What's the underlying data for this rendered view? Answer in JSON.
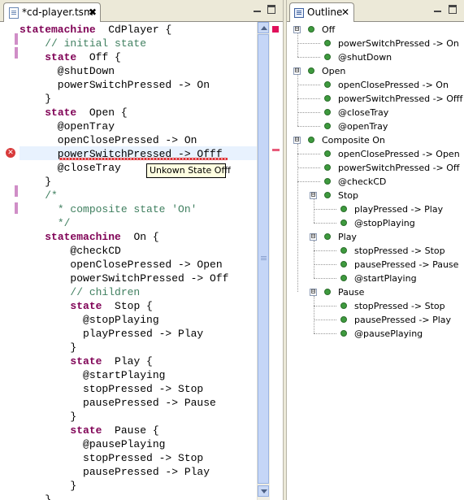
{
  "editor": {
    "tab_title": "*cd-player.tsm",
    "tab_close": "✖",
    "tooltip": "Unkown State Offf",
    "lines": [
      [
        [
          "kw",
          "statemachine"
        ],
        [
          "",
          "  CdPlayer {"
        ]
      ],
      [
        [
          "",
          "    "
        ],
        [
          "cm",
          "// initial state"
        ]
      ],
      [
        [
          "",
          "    "
        ],
        [
          "kw",
          "state"
        ],
        [
          "",
          "  Off {"
        ]
      ],
      [
        [
          "",
          "      @shutDown"
        ]
      ],
      [
        [
          "",
          "      powerSwitchPressed -> On"
        ]
      ],
      [
        [
          "",
          "    }"
        ]
      ],
      [
        [
          "",
          "    "
        ],
        [
          "kw",
          "state"
        ],
        [
          "",
          "  Open {"
        ]
      ],
      [
        [
          "",
          "      @openTray"
        ]
      ],
      [
        [
          "",
          "      openClosePressed -> On"
        ]
      ],
      [
        [
          "",
          "      powerSwitchPressed -> Offf"
        ]
      ],
      [
        [
          "",
          "      @closeTray"
        ]
      ],
      [
        [
          "",
          "    }"
        ]
      ],
      [
        [
          "",
          "    "
        ],
        [
          "cm",
          "/*"
        ]
      ],
      [
        [
          "",
          "    "
        ],
        [
          "cm",
          "  * composite state 'On'"
        ]
      ],
      [
        [
          "",
          "    "
        ],
        [
          "cm",
          "  */"
        ]
      ],
      [
        [
          "",
          "    "
        ],
        [
          "kw",
          "statemachine"
        ],
        [
          "",
          "  On {"
        ]
      ],
      [
        [
          "",
          "        @checkCD"
        ]
      ],
      [
        [
          "",
          "        openClosePressed -> Open"
        ]
      ],
      [
        [
          "",
          "        powerSwitchPressed -> Off"
        ]
      ],
      [
        [
          "",
          "        "
        ],
        [
          "cm",
          "// children"
        ]
      ],
      [
        [
          "",
          "        "
        ],
        [
          "kw",
          "state"
        ],
        [
          "",
          "  Stop {"
        ]
      ],
      [
        [
          "",
          "          @stopPlaying"
        ]
      ],
      [
        [
          "",
          "          playPressed -> Play"
        ]
      ],
      [
        [
          "",
          "        }"
        ]
      ],
      [
        [
          "",
          "        "
        ],
        [
          "kw",
          "state"
        ],
        [
          "",
          "  Play {"
        ]
      ],
      [
        [
          "",
          "          @startPlaying"
        ]
      ],
      [
        [
          "",
          "          stopPressed -> Stop"
        ]
      ],
      [
        [
          "",
          "          pausePressed -> Pause"
        ]
      ],
      [
        [
          "",
          "        }"
        ]
      ],
      [
        [
          "",
          "        "
        ],
        [
          "kw",
          "state"
        ],
        [
          "",
          "  Pause {"
        ]
      ],
      [
        [
          "",
          "          @pausePlaying"
        ]
      ],
      [
        [
          "",
          "          stopPressed -> Stop"
        ]
      ],
      [
        [
          "",
          "          pausePressed -> Play"
        ]
      ],
      [
        [
          "",
          "        }"
        ]
      ],
      [
        [
          "",
          "    }"
        ]
      ]
    ]
  },
  "outline": {
    "tab_title": "Outline",
    "tab_close": "✕",
    "nodes": [
      {
        "depth": 0,
        "expander": "⊟",
        "label": "Off"
      },
      {
        "depth": 1,
        "expander": "",
        "label": "powerSwitchPressed -> On"
      },
      {
        "depth": 1,
        "expander": "",
        "label": "@shutDown"
      },
      {
        "depth": 0,
        "expander": "⊟",
        "label": "Open"
      },
      {
        "depth": 1,
        "expander": "",
        "label": "openClosePressed -> On"
      },
      {
        "depth": 1,
        "expander": "",
        "label": "powerSwitchPressed -> Offf"
      },
      {
        "depth": 1,
        "expander": "",
        "label": "@closeTray"
      },
      {
        "depth": 1,
        "expander": "",
        "label": "@openTray"
      },
      {
        "depth": 0,
        "expander": "⊟",
        "label": "Composite On"
      },
      {
        "depth": 1,
        "expander": "",
        "label": "openClosePressed -> Open"
      },
      {
        "depth": 1,
        "expander": "",
        "label": "powerSwitchPressed -> Off"
      },
      {
        "depth": 1,
        "expander": "",
        "label": "@checkCD"
      },
      {
        "depth": 1,
        "expander": "⊟",
        "label": "Stop"
      },
      {
        "depth": 2,
        "expander": "",
        "label": "playPressed -> Play"
      },
      {
        "depth": 2,
        "expander": "",
        "label": "@stopPlaying"
      },
      {
        "depth": 1,
        "expander": "⊟",
        "label": "Play"
      },
      {
        "depth": 2,
        "expander": "",
        "label": "stopPressed -> Stop"
      },
      {
        "depth": 2,
        "expander": "",
        "label": "pausePressed -> Pause"
      },
      {
        "depth": 2,
        "expander": "",
        "label": "@startPlaying"
      },
      {
        "depth": 1,
        "expander": "⊟",
        "label": "Pause"
      },
      {
        "depth": 2,
        "expander": "",
        "label": "stopPressed -> Stop"
      },
      {
        "depth": 2,
        "expander": "",
        "label": "pausePressed -> Play"
      },
      {
        "depth": 2,
        "expander": "",
        "label": "@pausePlaying"
      }
    ]
  },
  "colors": {
    "keyword": "#7f0055",
    "comment": "#3f7f5f",
    "node_dot": "#3e9a3e",
    "error": "#d83a3a"
  }
}
